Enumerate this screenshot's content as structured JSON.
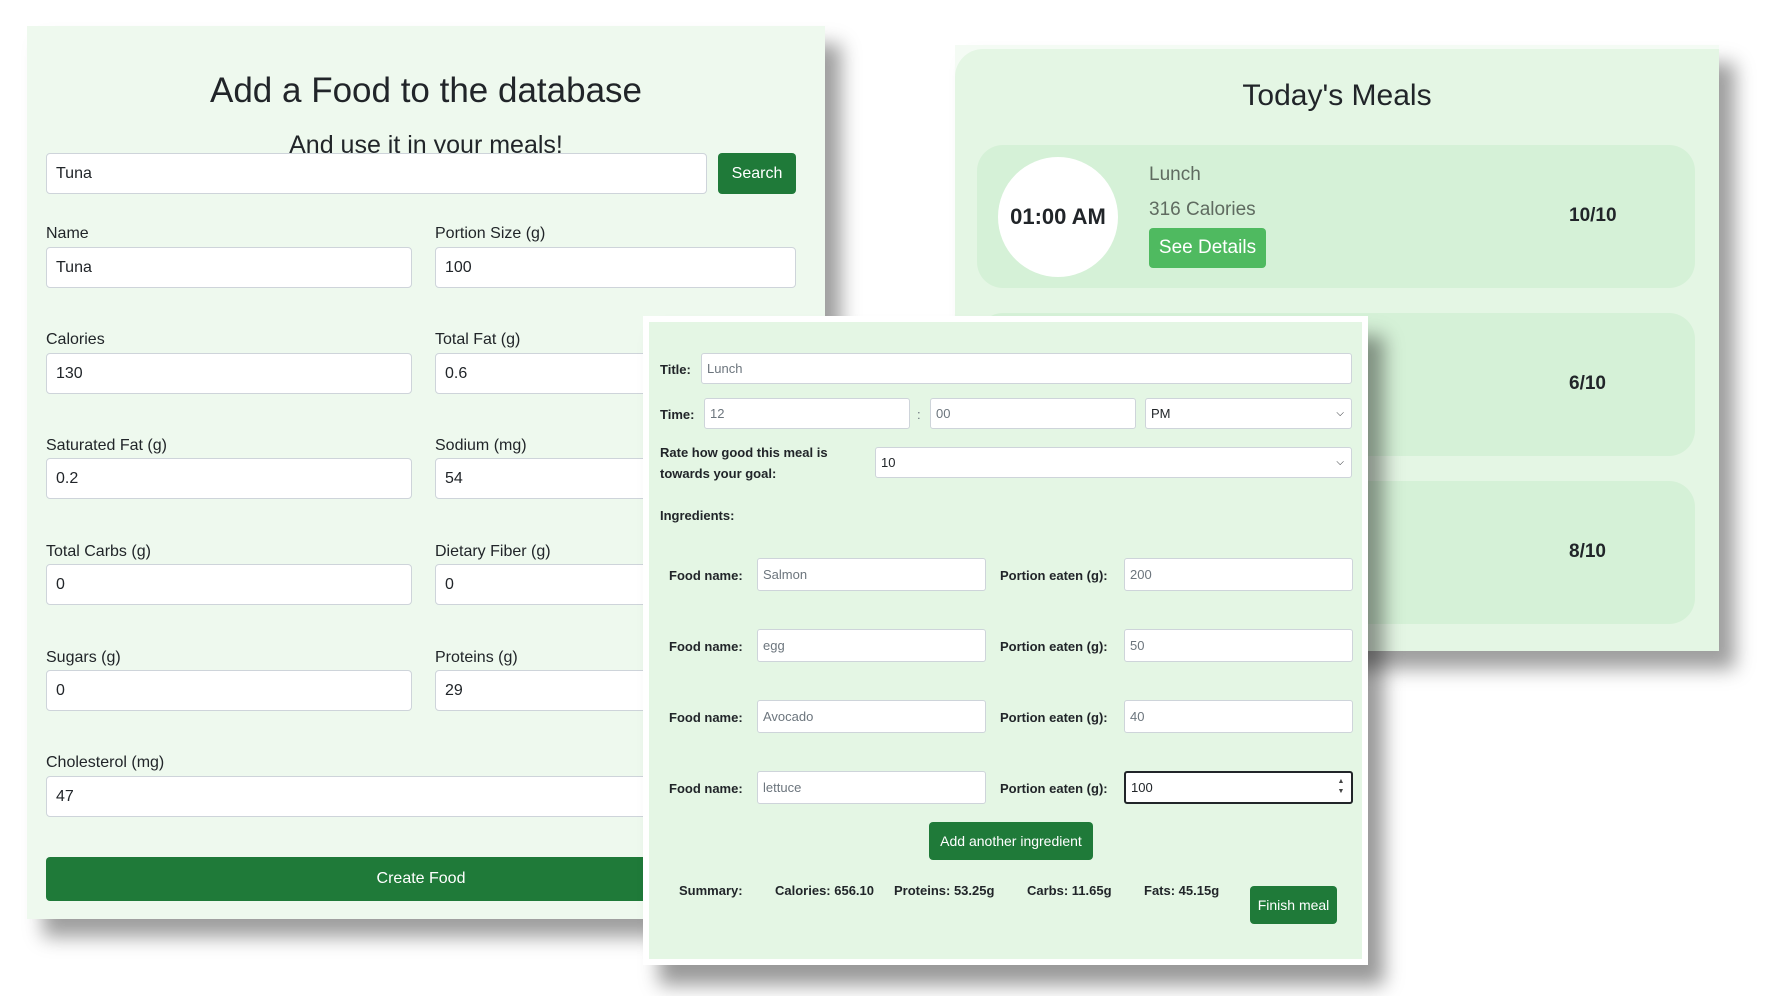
{
  "food_form": {
    "title": "Add a Food to the database",
    "subtitle": "And use it in your meals!",
    "search_value": "Tuna",
    "search_label": "Search",
    "fields": [
      {
        "label": "Name",
        "value": "Tuna"
      },
      {
        "label": "Portion Size (g)",
        "value": "100"
      },
      {
        "label": "Calories",
        "value": "130"
      },
      {
        "label": "Total Fat (g)",
        "value": "0.6"
      },
      {
        "label": "Saturated Fat (g)",
        "value": "0.2"
      },
      {
        "label": "Sodium (mg)",
        "value": "54"
      },
      {
        "label": "Total Carbs (g)",
        "value": "0"
      },
      {
        "label": "Dietary Fiber (g)",
        "value": "0"
      },
      {
        "label": "Sugars (g)",
        "value": "0"
      },
      {
        "label": "Proteins (g)",
        "value": "29"
      },
      {
        "label": "Cholesterol (mg)",
        "value": "47"
      }
    ],
    "create_label": "Create Food",
    "accent_color": "#1f7a39"
  },
  "meals": {
    "title": "Today's Meals",
    "cards": [
      {
        "time": "01:00 AM",
        "name": "Lunch",
        "calories": "316 Calories",
        "details_label": "See Details",
        "rating": "10/10"
      },
      {
        "rating": "6/10"
      },
      {
        "rating": "8/10"
      }
    ],
    "details_color": "#4fba60"
  },
  "editor": {
    "title_label": "Title:",
    "title_value": "Lunch",
    "time_label": "Time:",
    "hour": "12",
    "colon": ":",
    "minute": "00",
    "ampm": "PM",
    "rate_label": "Rate how good this meal is towards your goal:",
    "rate_value": "10",
    "ingredients_label": "Ingredients:",
    "food_name_label": "Food name:",
    "portion_label": "Portion eaten (g):",
    "ingredients": [
      {
        "name": "Salmon",
        "portion": "200"
      },
      {
        "name": "egg",
        "portion": "50"
      },
      {
        "name": "Avocado",
        "portion": "40"
      },
      {
        "name": "lettuce",
        "portion": "100"
      }
    ],
    "add_label": "Add another ingredient",
    "summary": {
      "label": "Summary:",
      "calories": "Calories: 656.10",
      "proteins": "Proteins: 53.25g",
      "carbs": "Carbs: 11.65g",
      "fats": "Fats: 45.15g"
    },
    "finish_label": "Finish meal"
  }
}
